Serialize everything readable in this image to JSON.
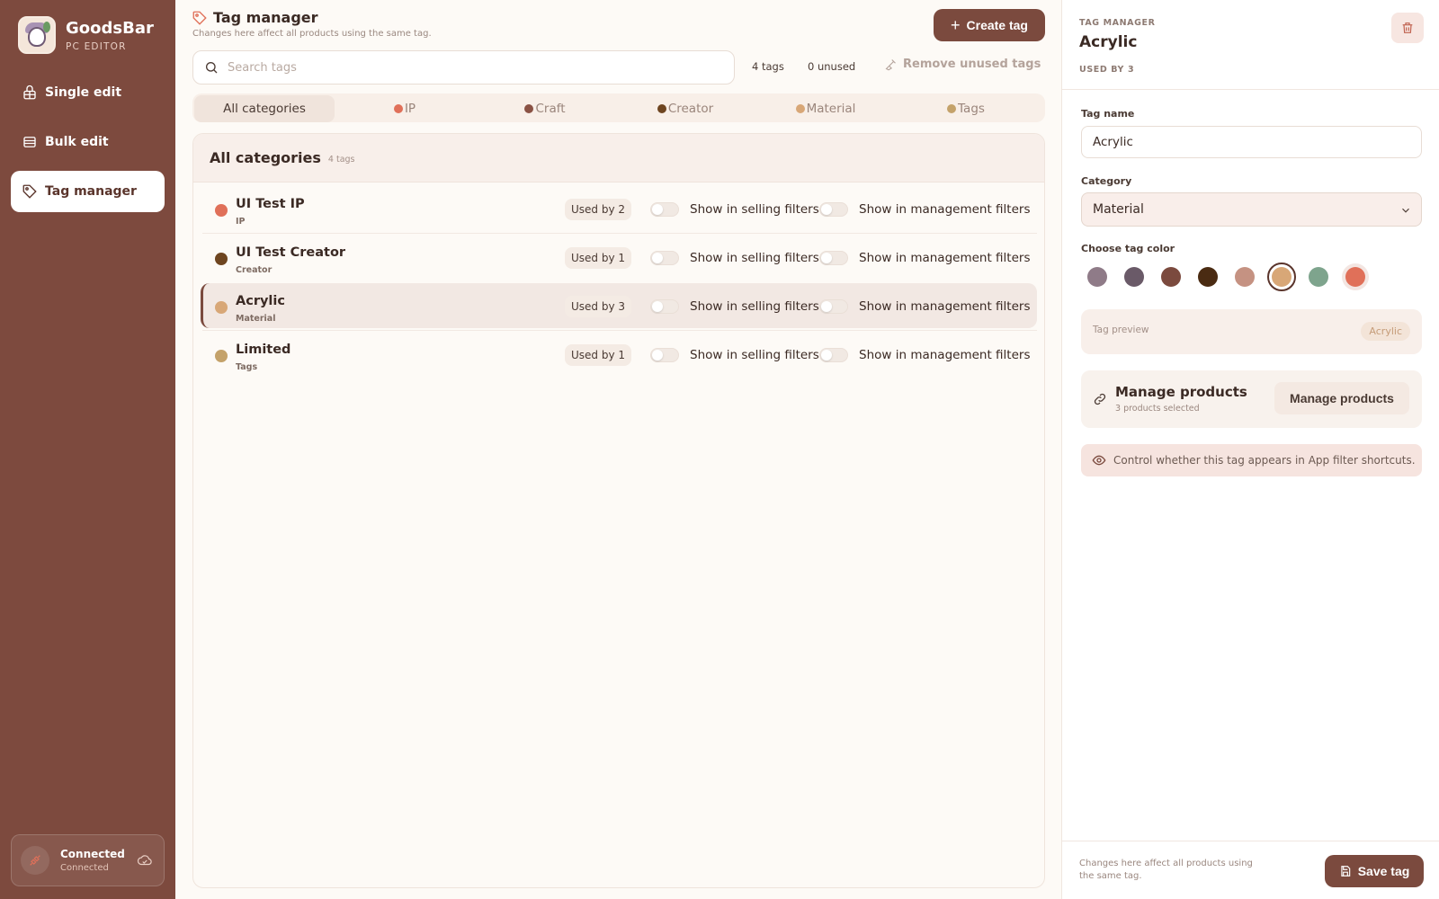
{
  "app": {
    "name": "GoodsBar",
    "subtitle": "PC EDITOR"
  },
  "sidebar": {
    "items": [
      {
        "label": "Single edit",
        "icon": "package-icon",
        "active": false
      },
      {
        "label": "Bulk edit",
        "icon": "layers-icon",
        "active": false
      },
      {
        "label": "Tag manager",
        "icon": "tag-icon",
        "active": true
      }
    ],
    "connection": {
      "title": "Connected",
      "status": "Connected"
    }
  },
  "header": {
    "title": "Tag manager",
    "subtitle": "Changes here affect all products using the same tag.",
    "create_label": "Create tag"
  },
  "toolbar": {
    "search_placeholder": "Search tags",
    "tag_count": "4 tags",
    "unused_count": "0 unused",
    "remove_unused_label": "Remove unused tags"
  },
  "tabs": [
    {
      "label": "All categories",
      "color": null,
      "active": true
    },
    {
      "label": "IP",
      "color": "#e07059",
      "active": false
    },
    {
      "label": "Craft",
      "color": "#8a5244",
      "active": false
    },
    {
      "label": "Creator",
      "color": "#6e4520",
      "active": false
    },
    {
      "label": "Material",
      "color": "#d8a777",
      "active": false
    },
    {
      "label": "Tags",
      "color": "#c4a26a",
      "active": false
    }
  ],
  "list": {
    "title": "All categories",
    "count": "4 tags",
    "selling_label": "Show in selling filters",
    "management_label": "Show in management filters",
    "rows": [
      {
        "name": "UI Test IP",
        "category": "IP",
        "used": "Used by 2",
        "color": "#e07059",
        "selected": false,
        "selling": false,
        "management": false
      },
      {
        "name": "UI Test Creator",
        "category": "Creator",
        "used": "Used by 1",
        "color": "#6e4520",
        "selected": false,
        "selling": false,
        "management": false
      },
      {
        "name": "Acrylic",
        "category": "Material",
        "used": "Used by 3",
        "color": "#d8a777",
        "selected": true,
        "selling": false,
        "management": false
      },
      {
        "name": "Limited",
        "category": "Tags",
        "used": "Used by 1",
        "color": "#c4a26a",
        "selected": false,
        "selling": false,
        "management": false
      }
    ]
  },
  "detail": {
    "eyebrow": "TAG MANAGER",
    "title": "Acrylic",
    "used": "USED BY 3",
    "name_label": "Tag name",
    "name_value": "Acrylic",
    "category_label": "Category",
    "category_value": "Material",
    "color_label": "Choose tag color",
    "colors": [
      "#8f7b88",
      "#6a5a68",
      "#7b4a3e",
      "#4a2b12",
      "#c59282",
      "#d8a777",
      "#7ea48d",
      "#e07059"
    ],
    "selected_color_index": 5,
    "preview_label": "Tag preview",
    "preview_chip": "Acrylic",
    "manage_title": "Manage products",
    "manage_sub": "3 products selected",
    "manage_button": "Manage products",
    "info": "Control whether this tag appears in App filter shortcuts.",
    "footer": "Changes here affect all products using the same tag.",
    "save_label": "Save tag"
  }
}
